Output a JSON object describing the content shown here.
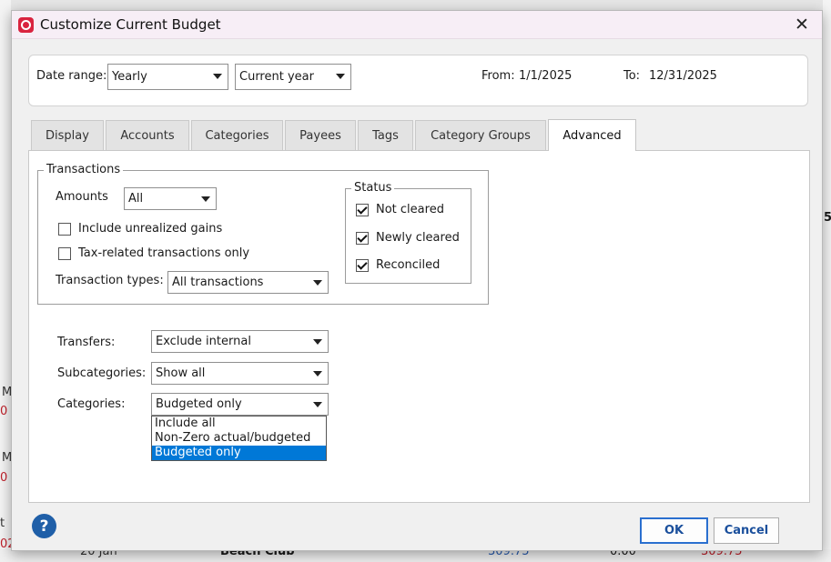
{
  "dialog": {
    "title": "Customize Current Budget",
    "close_glyph": "✕"
  },
  "date_range": {
    "label": "Date range:",
    "period": "Yearly",
    "scope": "Current year",
    "from_label": "From:",
    "from_value": "1/1/2025",
    "to_label": "To:",
    "to_value": "12/31/2025"
  },
  "tabs": [
    {
      "label": "Display"
    },
    {
      "label": "Accounts"
    },
    {
      "label": "Categories"
    },
    {
      "label": "Payees"
    },
    {
      "label": "Tags"
    },
    {
      "label": "Category Groups"
    },
    {
      "label": "Advanced",
      "active": true
    }
  ],
  "transactions": {
    "legend": "Transactions",
    "amounts_label": "Amounts",
    "amounts_value": "All",
    "include_unrealized": {
      "label": "Include unrealized gains",
      "checked": false
    },
    "tax_related": {
      "label": "Tax-related transactions only",
      "checked": false
    },
    "types_label": "Transaction types:",
    "types_value": "All transactions"
  },
  "status": {
    "legend": "Status",
    "not_cleared": {
      "label": "Not cleared",
      "checked": true
    },
    "newly_cleared": {
      "label": "Newly cleared",
      "checked": true
    },
    "reconciled": {
      "label": "Reconciled",
      "checked": true
    }
  },
  "filters": {
    "transfers_label": "Transfers:",
    "transfers_value": "Exclude internal",
    "subcategories_label": "Subcategories:",
    "subcategories_value": "Show all",
    "categories_label": "Categories:",
    "categories_value": "Budgeted only",
    "categories_options": [
      "Include all",
      "Non-Zero actual/budgeted",
      "Budgeted only"
    ]
  },
  "buttons": {
    "help": "?",
    "ok": "OK",
    "cancel": "Cancel"
  },
  "background": {
    "right_edge": "5",
    "left_frag_1": "M",
    "left_frag_2": "0",
    "left_frag_3": "M",
    "left_frag_4": "0",
    "left_frag_5": "t",
    "left_frag_6": "02",
    "bottom_date": "20 Jan",
    "bottom_payee": "Beach Club",
    "bottom_val_1": "309.75",
    "bottom_val_2": "0.00",
    "bottom_val_3": "309.75"
  },
  "colors": {
    "accent": "#0078d7",
    "app_icon": "#d9233f",
    "button_text": "#1a4f9c",
    "negative": "#c0202a"
  }
}
